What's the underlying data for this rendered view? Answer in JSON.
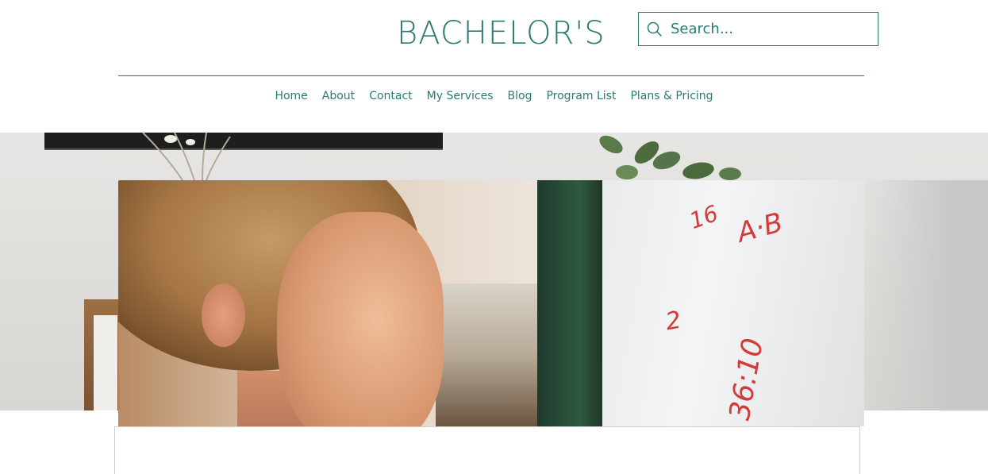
{
  "header": {
    "brand": "BACHELOR'S",
    "search": {
      "placeholder": "Search...",
      "icon": "search-icon"
    },
    "nav": [
      {
        "label": "Home"
      },
      {
        "label": "About"
      },
      {
        "label": "Contact"
      },
      {
        "label": "My Services"
      },
      {
        "label": "Blog"
      },
      {
        "label": "Program List"
      },
      {
        "label": "Plans & Pricing"
      }
    ]
  },
  "hero": {
    "scribbles": [
      "A·B",
      "16",
      "2",
      "36:10"
    ]
  },
  "colors": {
    "accent": "#2a7a72",
    "background": "#ffffff"
  }
}
